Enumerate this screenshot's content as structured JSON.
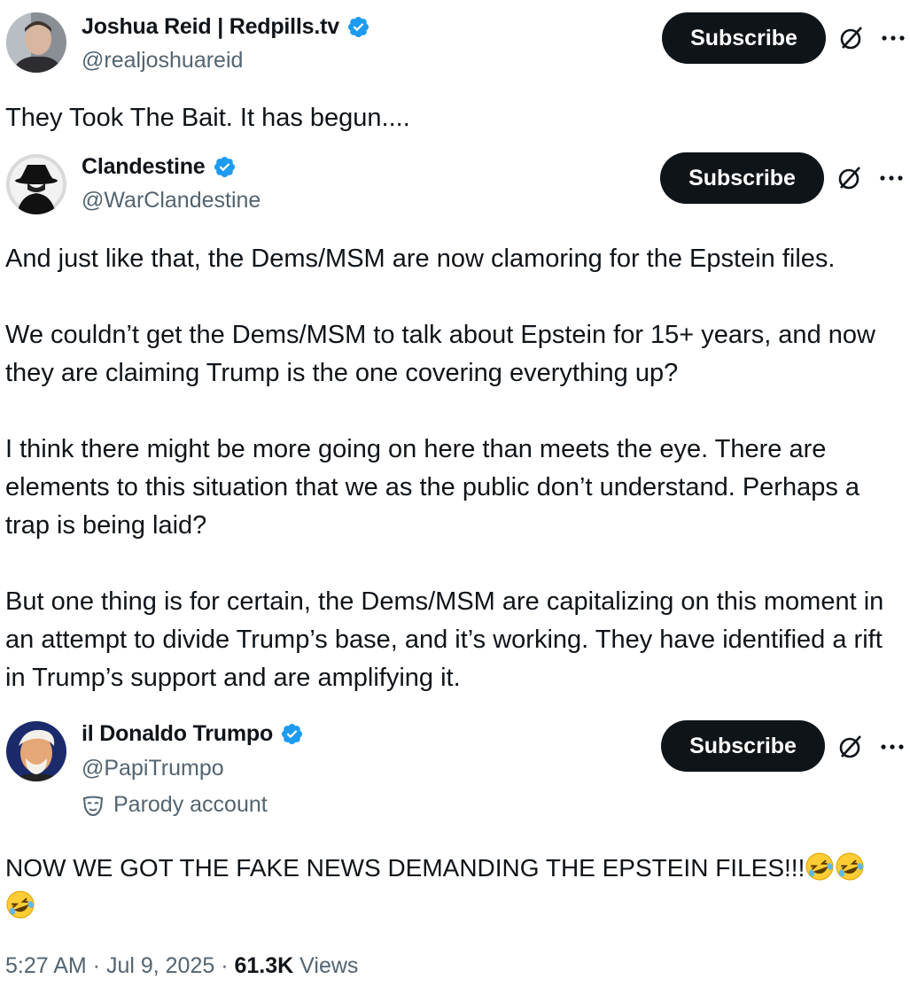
{
  "posts": [
    {
      "display_name": "Joshua Reid | Redpills.tv",
      "handle": "@realjoshuareid",
      "subscribe_label": "Subscribe",
      "text": "They Took The Bait. It has begun...."
    },
    {
      "display_name": "Clandestine",
      "handle": "@WarClandestine",
      "subscribe_label": "Subscribe",
      "paragraphs": [
        "And just like that, the Dems/MSM are now clamoring for the Epstein files.",
        "We couldn’t get the Dems/MSM to talk about Epstein for 15+ years, and now they are claiming Trump is the one covering everything up?",
        "I think there might be more going on here than meets the eye. There are elements to this situation that we as the public don’t understand. Perhaps a trap is being laid?",
        "But one thing is for certain, the Dems/MSM are capitalizing on this moment in an attempt to divide Trump’s base, and it’s working. They have identified a rift in Trump’s support and are amplifying it."
      ]
    },
    {
      "display_name": "il Donaldo Trumpo",
      "handle": "@PapiTrumpo",
      "subscribe_label": "Subscribe",
      "parody_label": "Parody account",
      "text": "NOW WE GOT THE FAKE NEWS DEMANDING THE EPSTEIN FILES!!!"
    }
  ],
  "footer": {
    "time": "5:27 AM",
    "separator": " · ",
    "date": "Jul 9, 2025",
    "views_count": "61.3K",
    "views_label": " Views"
  },
  "colors": {
    "text": "#0f1419",
    "secondary": "#536471",
    "verified": "#1d9bf0",
    "button": "#0f1419"
  },
  "icons": [
    "verified-badge-icon",
    "grok-icon",
    "more-icon",
    "parody-mask-icon",
    "laughing-emoji-icon"
  ]
}
